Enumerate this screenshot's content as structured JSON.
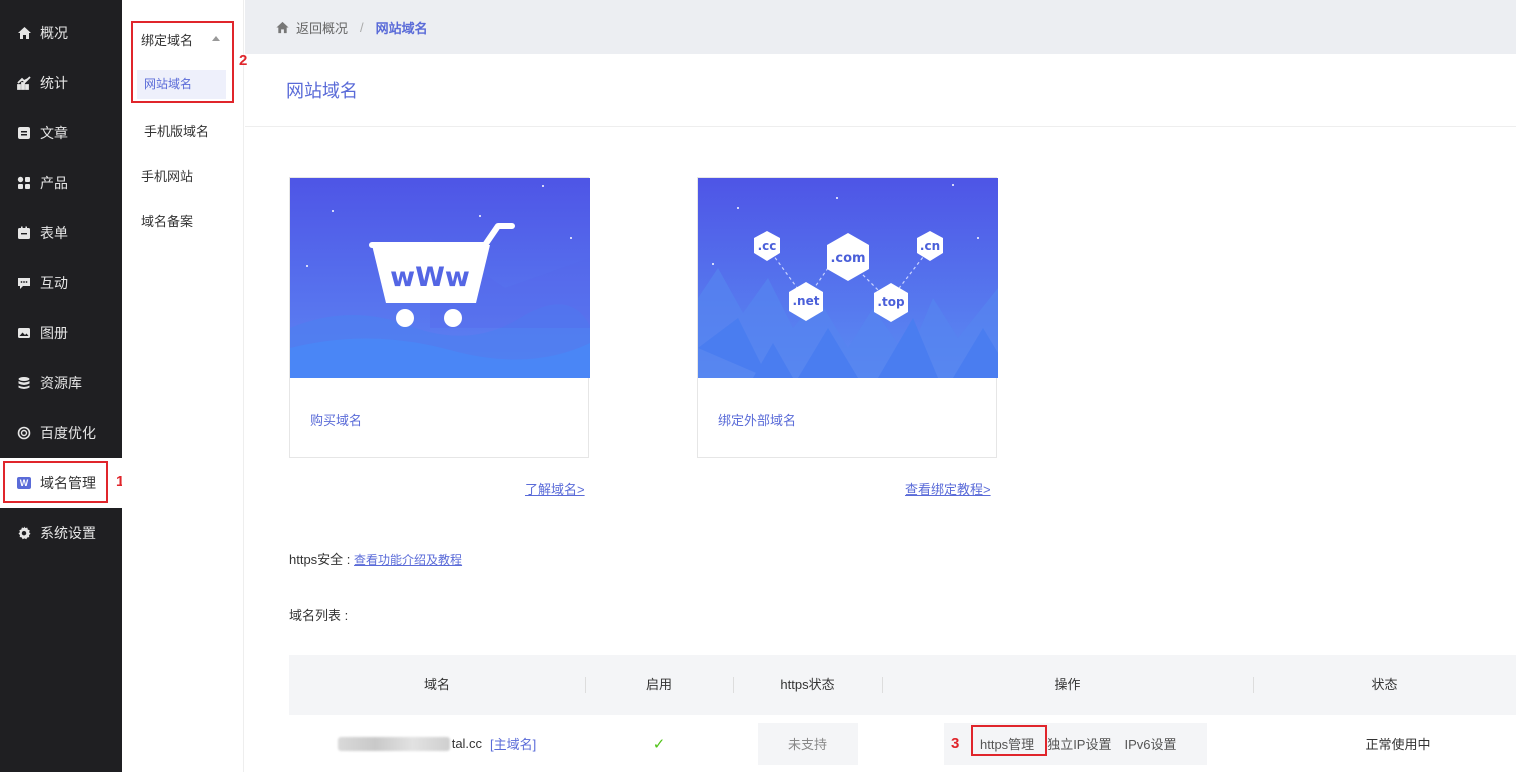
{
  "sidebar": {
    "items": [
      {
        "label": "概况",
        "icon": "home-icon"
      },
      {
        "label": "统计",
        "icon": "stats-icon"
      },
      {
        "label": "文章",
        "icon": "article-icon"
      },
      {
        "label": "产品",
        "icon": "product-icon"
      },
      {
        "label": "表单",
        "icon": "form-icon"
      },
      {
        "label": "互动",
        "icon": "chat-icon"
      },
      {
        "label": "图册",
        "icon": "gallery-icon"
      },
      {
        "label": "资源库",
        "icon": "database-icon"
      },
      {
        "label": "百度优化",
        "icon": "seo-icon"
      },
      {
        "label": "域名管理",
        "icon": "w-badge-icon",
        "badge": "W"
      },
      {
        "label": "系统设置",
        "icon": "gear-icon"
      }
    ],
    "active_index": 9
  },
  "submenu": {
    "group_label": "绑定域名",
    "active_label": "网站域名",
    "items": [
      "手机版域名",
      "手机网站",
      "域名备案"
    ]
  },
  "annotations": [
    "1",
    "2",
    "3"
  ],
  "breadcrumb": {
    "back_label": "返回概况",
    "separator": "/",
    "current": "网站域名"
  },
  "page_title": "网站域名",
  "cards": {
    "buy": {
      "label": "购买域名",
      "link": "了解域名>",
      "banner_text": "wWw"
    },
    "bind": {
      "label": "绑定外部域名",
      "link": "查看绑定教程>",
      "tlds": [
        ".cc",
        ".com",
        ".cn",
        ".net",
        ".top"
      ]
    }
  },
  "https": {
    "label": "https安全 :",
    "link": "查看功能介绍及教程"
  },
  "list_title": "域名列表 :",
  "table": {
    "headers": [
      "域名",
      "启用",
      "https状态",
      "操作",
      "状态"
    ],
    "rows": [
      {
        "domain_suffix": "tal.cc",
        "main_tag": "[主域名]",
        "enabled": "✓",
        "https_status": "未支持",
        "ops": [
          "https管理",
          "独立IP设置",
          "IPv6设置"
        ],
        "status": "正常使用中"
      }
    ]
  },
  "colors": {
    "accent": "#5a6bd8",
    "sidebar_bg": "#1f1f22",
    "annotation": "#e0252b"
  }
}
